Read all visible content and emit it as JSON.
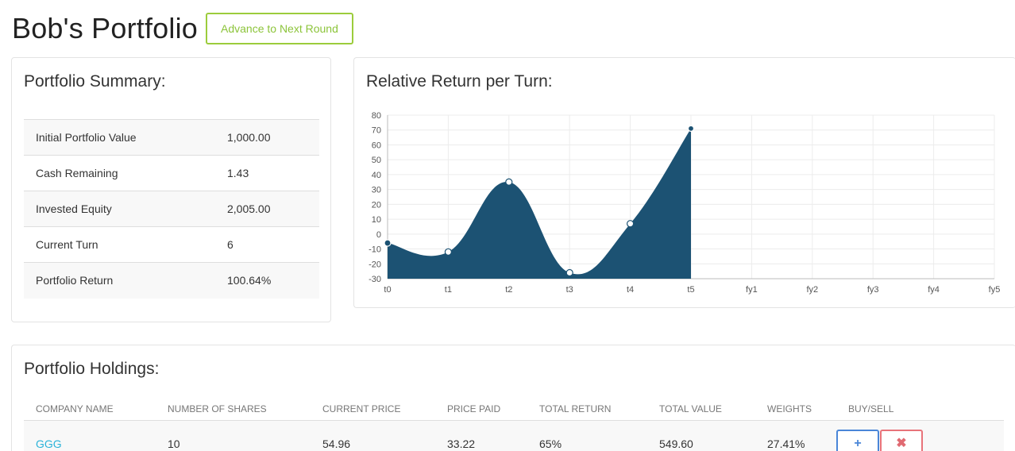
{
  "header": {
    "title": "Bob's Portfolio",
    "advance_label": "Advance to Next Round"
  },
  "summary": {
    "title": "Portfolio Summary:",
    "rows": [
      {
        "label": "Initial Portfolio Value",
        "value": "1,000.00"
      },
      {
        "label": "Cash Remaining",
        "value": "1.43"
      },
      {
        "label": "Invested Equity",
        "value": "2,005.00"
      },
      {
        "label": "Current Turn",
        "value": "6"
      },
      {
        "label": "Portfolio Return",
        "value": "100.64%"
      }
    ]
  },
  "chart": {
    "title": "Relative Return per Turn:"
  },
  "chart_data": {
    "type": "area",
    "title": "Relative Return per Turn:",
    "categories": [
      "t0",
      "t1",
      "t2",
      "t3",
      "t4",
      "t5",
      "fy1",
      "fy2",
      "fy3",
      "fy4",
      "fy5"
    ],
    "series": [
      {
        "values": [
          -6,
          -12,
          35,
          -26,
          7,
          71
        ]
      }
    ],
    "y_ticks": [
      80,
      70,
      60,
      50,
      40,
      30,
      20,
      10,
      0,
      -10,
      -20,
      -30
    ],
    "ylim": [
      -30,
      80
    ],
    "grid": true,
    "colors": {
      "fill": "#1c5273",
      "point": "#1c5273"
    }
  },
  "holdings": {
    "title": "Portfolio Holdings:",
    "columns": [
      "Company Name",
      "Number of Shares",
      "Current Price",
      "Price Paid",
      "Total Return",
      "Total Value",
      "Weights",
      "Buy/Sell"
    ],
    "rows": [
      {
        "company": "GGG",
        "shares": "10",
        "current_price": "54.96",
        "price_paid": "33.22",
        "total_return": "65%",
        "total_value": "549.60",
        "weight": "27.41%",
        "buy_label": "+",
        "sell_label": "✖"
      }
    ]
  },
  "colors": {
    "accent_green": "#9ccc3c",
    "link_blue": "#2bb3d9",
    "buy_blue": "#4a86d8",
    "sell_red": "#e8737a",
    "chart_fill": "#1c5273"
  }
}
